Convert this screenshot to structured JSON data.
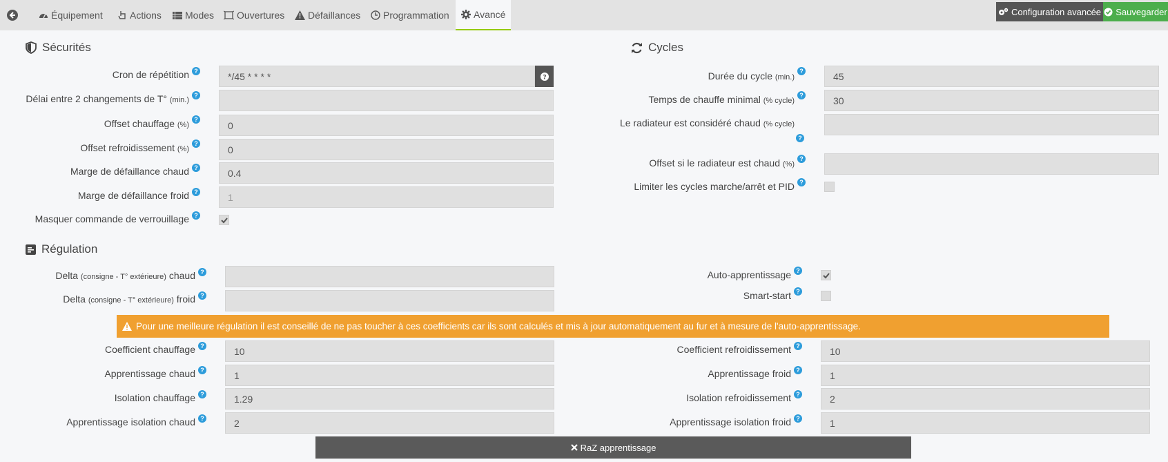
{
  "tabs": [
    {
      "label": "Équipement"
    },
    {
      "label": "Actions"
    },
    {
      "label": "Modes"
    },
    {
      "label": "Ouvertures"
    },
    {
      "label": "Défaillances"
    },
    {
      "label": "Programmation"
    },
    {
      "label": "Avancé",
      "active": true
    }
  ],
  "toolbar": {
    "config_label": "Configuration avancée",
    "save_label": "Sauvegarder"
  },
  "securites": {
    "title": "Sécurités",
    "cron": {
      "label": "Cron de répétition",
      "value": "*/45 * * * *"
    },
    "delai": {
      "label": "Délai entre 2 changements de T°",
      "unit": "(min.)",
      "value": ""
    },
    "offset_chauffage": {
      "label": "Offset chauffage",
      "unit": "(%)",
      "value": "0"
    },
    "offset_refroid": {
      "label": "Offset refroidissement",
      "unit": "(%)",
      "value": "0"
    },
    "marge_chaud": {
      "label": "Marge de défaillance chaud",
      "value": "0.4"
    },
    "marge_froid": {
      "label": "Marge de défaillance froid",
      "value": "1"
    },
    "masquer": {
      "label": "Masquer commande de verrouillage",
      "checked": true
    }
  },
  "cycles": {
    "title": "Cycles",
    "duree": {
      "label": "Durée du cycle",
      "unit": "(min.)",
      "value": "45"
    },
    "temps_chauffe": {
      "label": "Temps de chauffe minimal",
      "unit": "(% cycle)",
      "value": "30"
    },
    "radiateur_chaud": {
      "label": "Le radiateur est considéré chaud",
      "unit": "(% cycle)",
      "value": ""
    },
    "offset_radiateur": {
      "label": "Offset si le radiateur est chaud",
      "unit": "(%)",
      "value": ""
    },
    "limiter": {
      "label": "Limiter les cycles marche/arrêt et PID",
      "checked": false
    }
  },
  "regulation": {
    "title": "Régulation",
    "delta_chaud": {
      "label_a": "Delta",
      "label_sub": "(consigne - T° extérieure)",
      "label_b": "chaud",
      "value": ""
    },
    "delta_froid": {
      "label_a": "Delta",
      "label_sub": "(consigne - T° extérieure)",
      "label_b": "froid",
      "value": ""
    },
    "auto_apprentissage": {
      "label": "Auto-apprentissage",
      "checked": true
    },
    "smart_start": {
      "label": "Smart-start",
      "checked": false
    },
    "alert": "Pour une meilleure régulation il est conseillé de ne pas toucher à ces coefficients car ils sont calculés et mis à jour automatiquement au fur et à mesure de l'auto-apprentissage.",
    "coef_chauffage": {
      "label": "Coefficient chauffage",
      "value": "10"
    },
    "app_chaud": {
      "label": "Apprentissage chaud",
      "value": "1"
    },
    "iso_chauffage": {
      "label": "Isolation chauffage",
      "value": "1.29"
    },
    "app_iso_chaud": {
      "label": "Apprentissage isolation chaud",
      "value": "2"
    },
    "coef_refroid": {
      "label": "Coefficient refroidissement",
      "value": "10"
    },
    "app_froid": {
      "label": "Apprentissage froid",
      "value": "1"
    },
    "iso_refroid": {
      "label": "Isolation refroidissement",
      "value": "2"
    },
    "app_iso_froid": {
      "label": "Apprentissage isolation froid",
      "value": "1"
    },
    "raz_label": "RaZ apprentissage"
  },
  "colors": {
    "accent": "#94ca02",
    "save": "#4cae4c",
    "warning": "#f0a030",
    "help": "#2d9cdb"
  },
  "icons": {
    "back": "arrow-circle-left-icon",
    "help": "question-circle-icon"
  }
}
